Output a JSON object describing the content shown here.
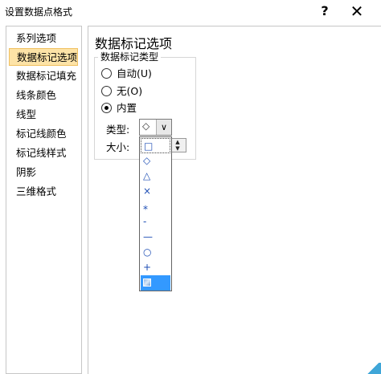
{
  "window": {
    "title": "设置数据点格式",
    "help_label": "?",
    "close_label": "✕"
  },
  "sidebar": {
    "items": [
      {
        "label": "系列选项"
      },
      {
        "label": "数据标记选项"
      },
      {
        "label": "数据标记填充"
      },
      {
        "label": "线条颜色"
      },
      {
        "label": "线型"
      },
      {
        "label": "标记线颜色"
      },
      {
        "label": "标记线样式"
      },
      {
        "label": "阴影"
      },
      {
        "label": "三维格式"
      }
    ],
    "selected_index": 1
  },
  "main": {
    "section_title": "数据标记选项",
    "group_label": "数据标记类型",
    "radios": [
      {
        "label": "自动(U)",
        "checked": false
      },
      {
        "label": "无(O)",
        "checked": false
      },
      {
        "label": "内置",
        "checked": true
      }
    ],
    "type_label": "类型:",
    "type_value": "◇",
    "size_label": "大小:",
    "dropdown_arrow": "∨",
    "spin_up": "▲",
    "spin_down": "▼"
  },
  "dropdown": {
    "items": [
      "□",
      "◇",
      "△",
      "×",
      "⁎",
      "‐",
      "—",
      "○",
      "+",
      "picture"
    ],
    "selected_index": 9
  },
  "colors": {
    "selection_highlight": "#fde3a7",
    "list_selection": "#3399ff",
    "marker_blue": "#1f4fb5"
  }
}
